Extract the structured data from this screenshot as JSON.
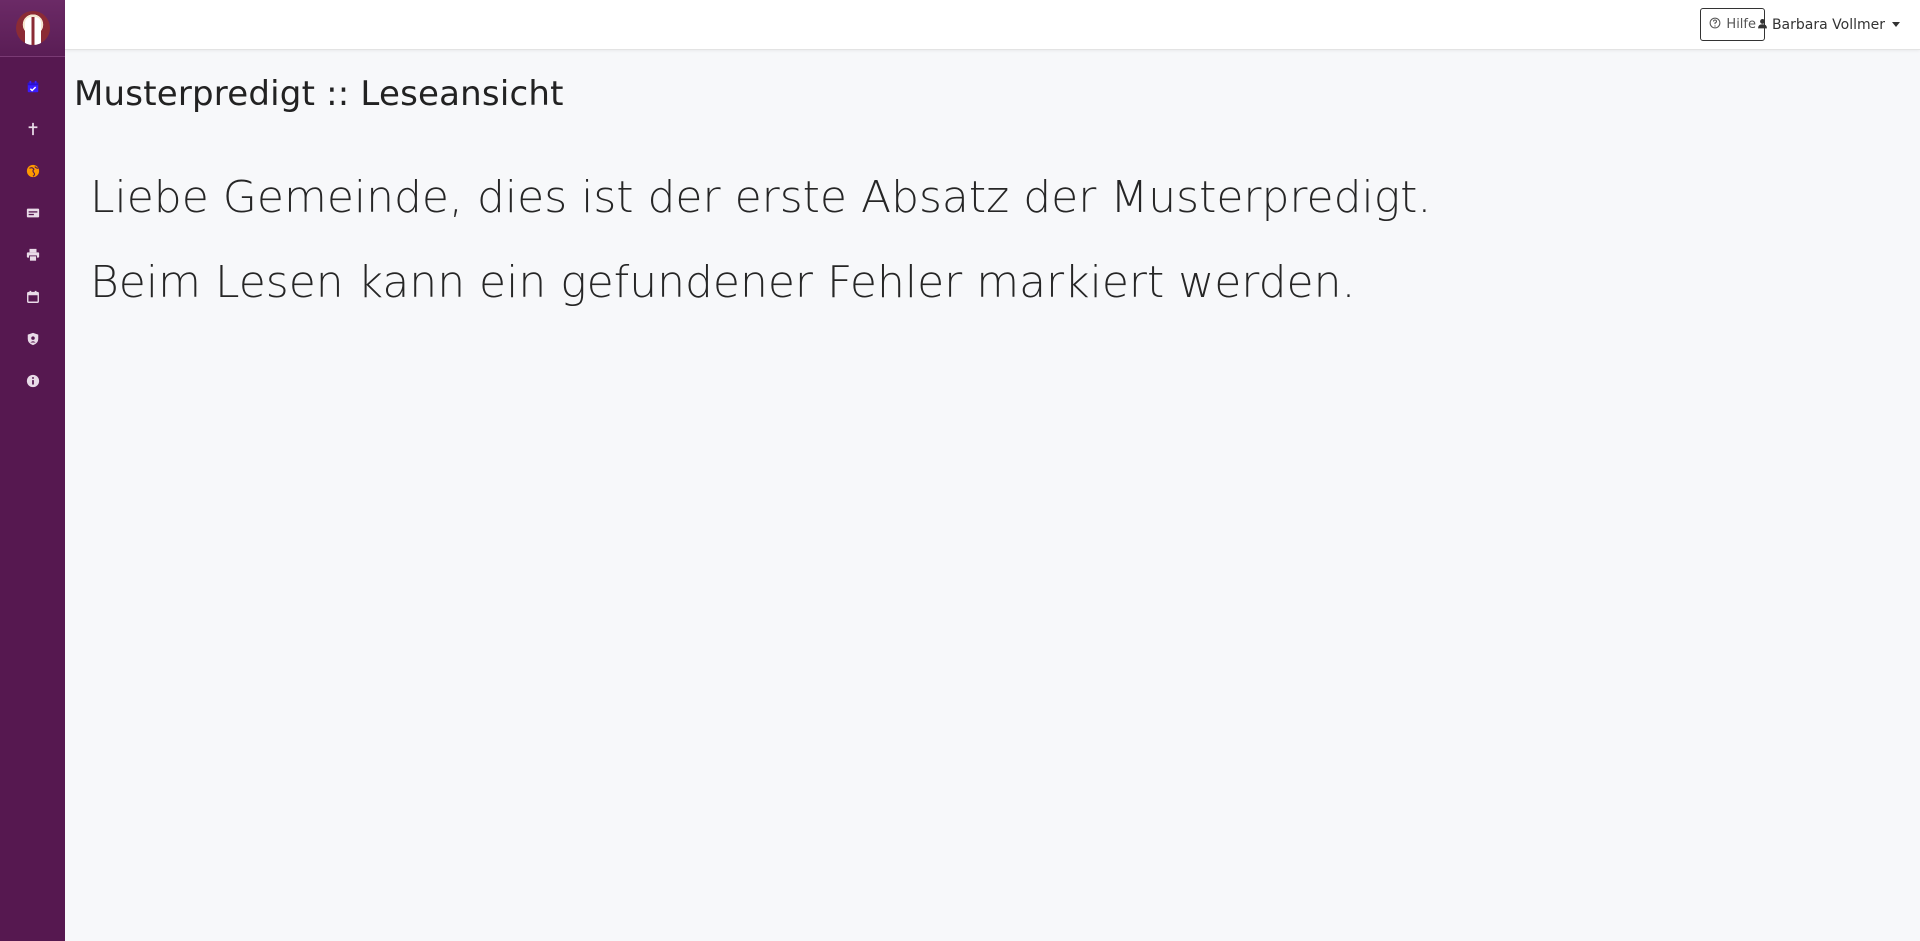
{
  "sidebar": {
    "logo": "church-logo",
    "items": [
      {
        "icon": "calendar-check-icon",
        "color": "#3b1dff"
      },
      {
        "icon": "cross-icon",
        "color": "#e9dbe8"
      },
      {
        "icon": "globe-icon",
        "color": "#ff9900"
      },
      {
        "icon": "id-card-icon",
        "color": "#e9dbe8"
      },
      {
        "icon": "printer-icon",
        "color": "#e9dbe8"
      },
      {
        "icon": "calendar-icon",
        "color": "#e9dbe8"
      },
      {
        "icon": "user-shield-icon",
        "color": "#e9dbe8"
      },
      {
        "icon": "info-icon",
        "color": "#e9dbe8"
      }
    ]
  },
  "topbar": {
    "help_label": "Hilfe",
    "user_name": "Barbara Vollmer"
  },
  "page": {
    "title": "Musterpredigt :: Leseansicht"
  },
  "reading": {
    "paragraphs": [
      "Liebe Gemeinde, dies ist der erste Absatz der Musterpredigt.",
      "Beim Lesen kann ein gefundener Fehler markiert werden."
    ]
  },
  "colors": {
    "sidebar_bg": "#561850",
    "page_bg": "#f7f8fa"
  }
}
